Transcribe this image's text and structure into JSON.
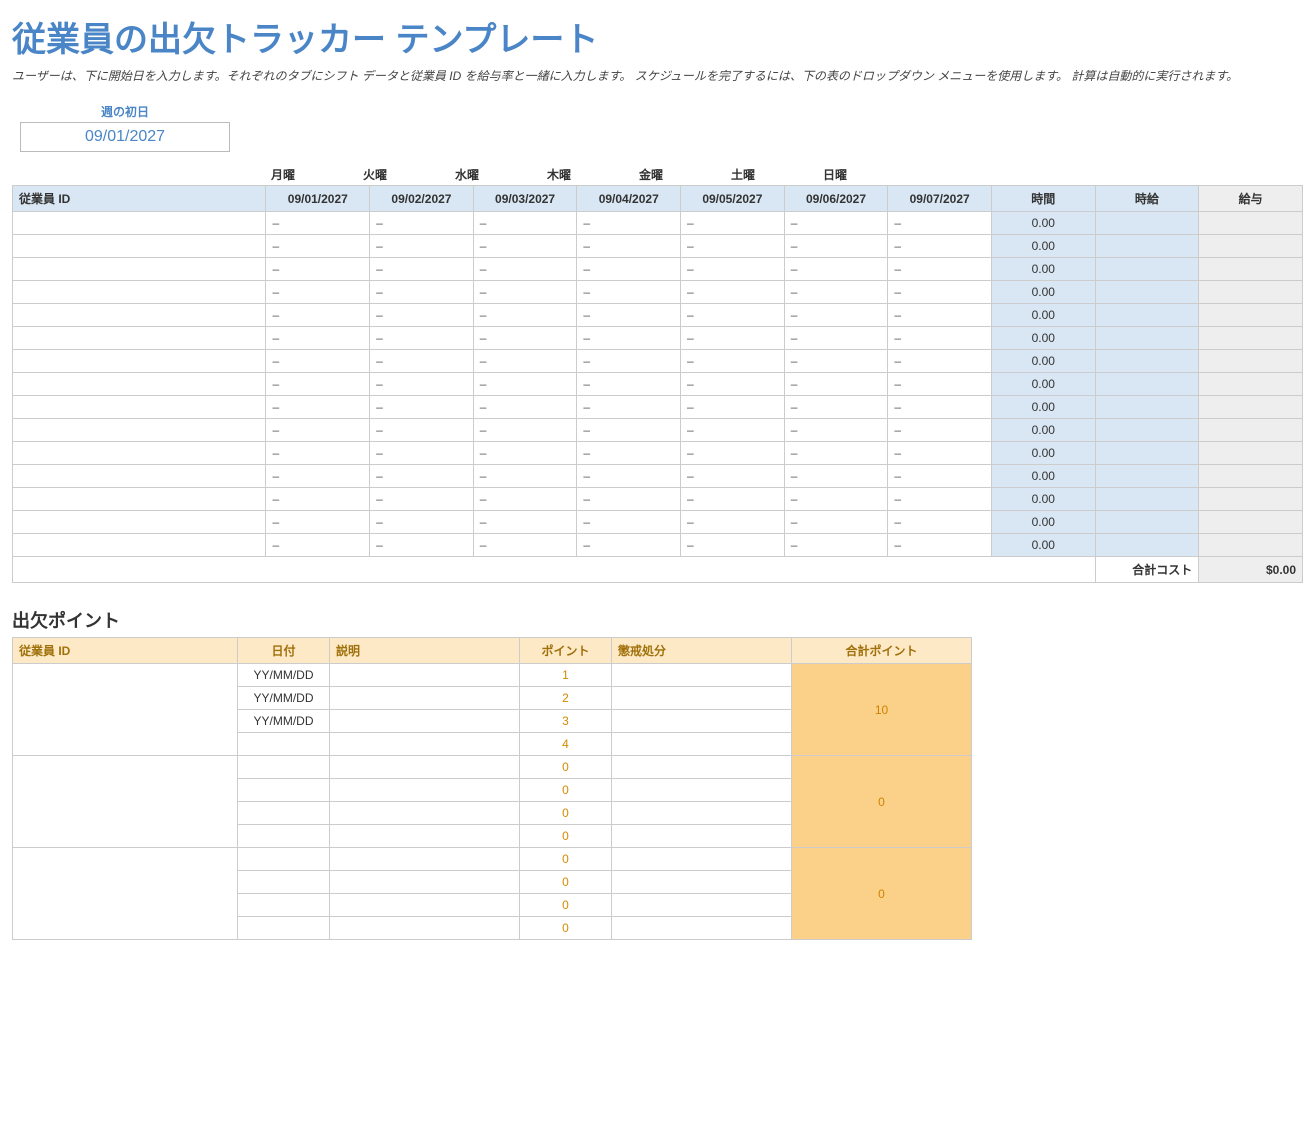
{
  "header": {
    "title": "従業員の出欠トラッカー テンプレート",
    "subtitle": "ユーザーは、下に開始日を入力します。それぞれのタブにシフト データと従業員 ID を給与率と一緒に入力します。 スケジュールを完了するには、下の表のドロップダウン メニューを使用します。 計算は自動的に実行されます。"
  },
  "week": {
    "label": "週の初日",
    "value": "09/01/2027"
  },
  "schedule": {
    "day_names": [
      "月曜",
      "火曜",
      "水曜",
      "木曜",
      "金曜",
      "土曜",
      "日曜"
    ],
    "headers": {
      "employee_id": "従業員 ID",
      "dates": [
        "09/01/2027",
        "09/02/2027",
        "09/03/2027",
        "09/04/2027",
        "09/05/2027",
        "09/06/2027",
        "09/07/2027"
      ],
      "hours": "時間",
      "rate": "時給",
      "pay": "給与"
    },
    "dash": "–",
    "row_count": 15,
    "hours_value": "0.00",
    "total_label": "合計コスト",
    "total_value": "$0.00"
  },
  "points": {
    "heading": "出欠ポイント",
    "headers": {
      "employee_id": "従業員 ID",
      "date": "日付",
      "description": "説明",
      "point": "ポイント",
      "discipline": "懲戒処分",
      "total": "合計ポイント"
    },
    "groups": [
      {
        "total": "10",
        "rows": [
          {
            "date": "YY/MM/DD",
            "point": "1"
          },
          {
            "date": "YY/MM/DD",
            "point": "2"
          },
          {
            "date": "YY/MM/DD",
            "point": "3"
          },
          {
            "date": "",
            "point": "4"
          }
        ]
      },
      {
        "total": "0",
        "rows": [
          {
            "date": "",
            "point": "0"
          },
          {
            "date": "",
            "point": "0"
          },
          {
            "date": "",
            "point": "0"
          },
          {
            "date": "",
            "point": "0"
          }
        ]
      },
      {
        "total": "0",
        "rows": [
          {
            "date": "",
            "point": "0"
          },
          {
            "date": "",
            "point": "0"
          },
          {
            "date": "",
            "point": "0"
          },
          {
            "date": "",
            "point": "0"
          }
        ]
      }
    ]
  }
}
